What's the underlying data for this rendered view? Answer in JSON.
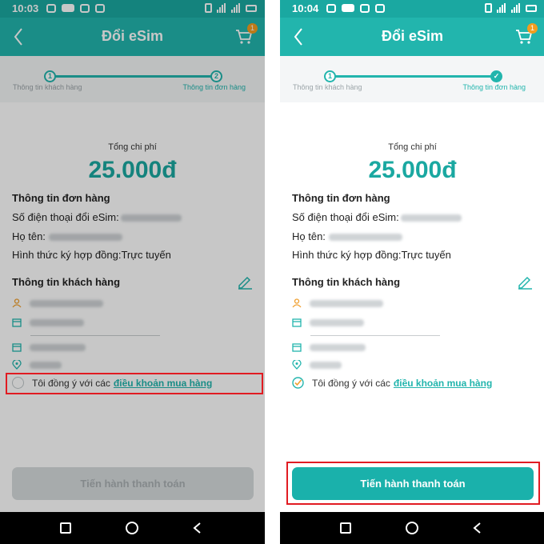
{
  "left": {
    "status": {
      "time": "10:03"
    },
    "header": {
      "title": "Đổi eSim",
      "cart_badge": "1"
    },
    "steps": {
      "step1_num": "1",
      "step2_num": "2",
      "step1_label": "Thông tin khách hàng",
      "step2_label": "Thông tin đơn hàng"
    },
    "total": {
      "label": "Tổng chi phí",
      "value": "25.000đ"
    },
    "order": {
      "title": "Thông tin đơn hàng",
      "phone_label": "Số điện thoại đổi eSim:",
      "name_label": "Họ tên:",
      "contract_label": "Hình thức ký hợp đồng:",
      "contract_value": "Trực tuyến"
    },
    "customer": {
      "title": "Thông tin khách hàng"
    },
    "agree": {
      "text": "Tôi đồng ý với các",
      "link": "điều khoản mua hàng",
      "checked": false
    },
    "pay_button": {
      "label": "Tiến hành thanh toán",
      "enabled": false
    }
  },
  "right": {
    "status": {
      "time": "10:04"
    },
    "header": {
      "title": "Đổi eSim",
      "cart_badge": "1"
    },
    "steps": {
      "step1_num": "1",
      "step2_num": "✓",
      "step1_label": "Thông tin khách hàng",
      "step2_label": "Thông tin đơn hàng"
    },
    "total": {
      "label": "Tổng chi phí",
      "value": "25.000đ"
    },
    "order": {
      "title": "Thông tin đơn hàng",
      "phone_label": "Số điện thoại đổi eSim:",
      "name_label": "Họ tên:",
      "contract_label": "Hình thức ký hợp đồng:",
      "contract_value": "Trực tuyến"
    },
    "customer": {
      "title": "Thông tin khách hàng"
    },
    "agree": {
      "text": "Tôi đồng ý với các",
      "link": "điều khoản mua hàng",
      "checked": true
    },
    "pay_button": {
      "label": "Tiến hành thanh toán",
      "enabled": true
    }
  },
  "colors": {
    "primary": "#22b5ad",
    "highlight": "#e11b22",
    "badge": "#f29d1f",
    "disabled": "#d7dbdd"
  },
  "icons": [
    "back-arrow-icon",
    "cart-icon",
    "edit-pencil-icon",
    "user-icon",
    "calendar-icon",
    "location-pin-icon",
    "check-circle-icon",
    "nav-recent-icon",
    "nav-home-icon",
    "nav-back-icon"
  ]
}
